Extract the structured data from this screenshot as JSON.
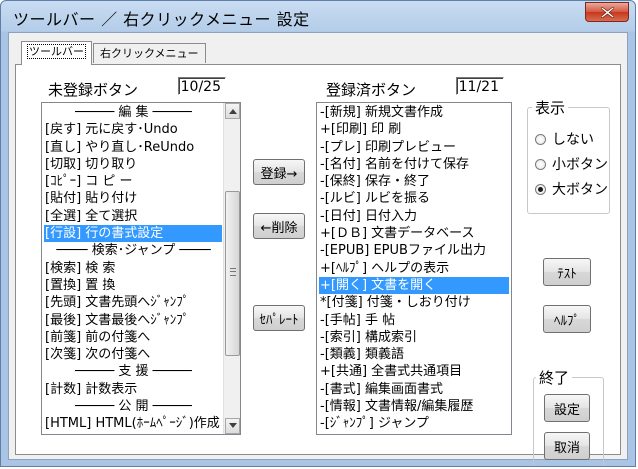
{
  "window": {
    "title": "ツールバー ／ 右クリックメニュー 設定"
  },
  "tabs": [
    {
      "label": "ツールバー"
    },
    {
      "label": "右クリックメニュー"
    }
  ],
  "unregistered": {
    "label": "未登録ボタン",
    "count": "10/25",
    "items": [
      "───── 編 集 ─────",
      "[戻す] 元に戻す･Undo",
      "[直し] やり直し･ReUndo",
      "[切取] 切り取り",
      "[ｺﾋﾟｰ] コ ピ ー",
      "[貼付] 貼り付け",
      "[全選] 全て選択",
      "[行設] 行の書式設定",
      "──── 検索･ジャンプ ────",
      "[検索] 検 索",
      "[置換] 置 換",
      "[先頭] 文書先頭へｼﾞｬﾝﾌﾟ",
      "[最後] 文書最後へｼﾞｬﾝﾌﾟ",
      "[前箋] 前の付箋へ",
      "[次箋] 次の付箋へ",
      "───── 支 援 ─────",
      "[計数] 計数表示",
      "───── 公 開 ─────",
      "[HTML] HTML(ﾎｰﾑﾍﾟｰｼﾞ)作成"
    ],
    "selected_index": 7
  },
  "registered": {
    "label": "登録済ボタン",
    "count": "11/21",
    "items": [
      "-[新規] 新規文書作成",
      "+[印刷] 印 刷",
      "-[プレ] 印刷プレビュー",
      "-[名付] 名前を付けて保存",
      "-[保終] 保存・終了",
      "-[ルビ] ルビを振る",
      "-[日付] 日付入力",
      "+[ＤＢ] 文書データベース",
      "-[EPUB] EPUBファイル出力",
      "+[ﾍﾙﾌﾟ] ヘルプの表示",
      "+[開く] 文書を開く",
      "*[付箋] 付箋・しおり付け",
      "-[手帖] 手 帖",
      "-[索引] 構成索引",
      "-[類義] 類義語",
      "+[共通] 全書式共通項目",
      "-[書式] 編集画面書式",
      "-[情報] 文書情報/編集履歴",
      "-[ｼﾞｬﾝﾌﾟ] ジャンプ"
    ],
    "selected_index": 10
  },
  "buttons": {
    "register": "登録→",
    "delete": "←削除",
    "separator": "ｾﾊﾟﾚｰﾄ",
    "test": "ﾃｽﾄ",
    "help": "ﾍﾙﾌﾟ",
    "settings": "設定",
    "cancel": "取消"
  },
  "display_group": {
    "title": "表示",
    "options": [
      {
        "label": "しない",
        "checked": false
      },
      {
        "label": "小ボタン",
        "checked": false
      },
      {
        "label": "大ボタン",
        "checked": true
      }
    ]
  },
  "end_group": {
    "title": "終了"
  },
  "colors": {
    "selection": "#3399ff",
    "title_bar": "#b4cde9",
    "close_button": "#c7371d"
  }
}
